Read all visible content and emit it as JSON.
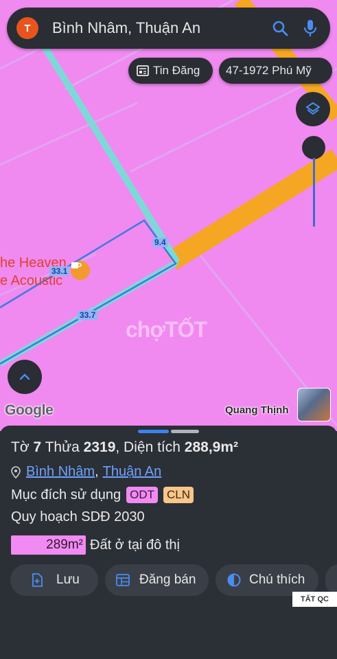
{
  "search": {
    "avatar_letter": "T",
    "query": "Bình Nhâm, Thuận An"
  },
  "chips": {
    "news_label": "Tin Đăng",
    "road_label": "47-1972 Phú Mỹ"
  },
  "map": {
    "poi_line1": "he Heaven",
    "poi_line2": "e Acoustic",
    "dim_a": "9.4",
    "dim_b": "33.1",
    "dim_c": "33.7",
    "watermark": "chợTỐT",
    "google": "Google",
    "user_name": "Quang Thịnh"
  },
  "parcel": {
    "title_prefix": "Tờ ",
    "sheet_no": "7",
    "plot_word": " Thửa ",
    "plot_no": "2319",
    "area_label": ", Diện tích ",
    "area_value": "288,9m²",
    "ward": "Bình Nhâm",
    "separator": ",",
    "city": "Thuận An",
    "purpose_label": "Mục đích sử dụng",
    "badge_odt": "ODT",
    "badge_cln": "CLN",
    "plan_label": "Quy hoạch SDĐ 2030",
    "area_box": "289m²",
    "area_desc": "Đất ở tại đô thị"
  },
  "actions": {
    "save": "Lưu",
    "post": "Đăng bán",
    "legend": "Chú thích"
  },
  "ad_tag": "TẤT QC",
  "colors": {
    "map_pink": "#f08af0",
    "road_orange": "#f5a623",
    "road_cyan": "#7fd8d8",
    "accent_blue": "#3b82f6"
  }
}
